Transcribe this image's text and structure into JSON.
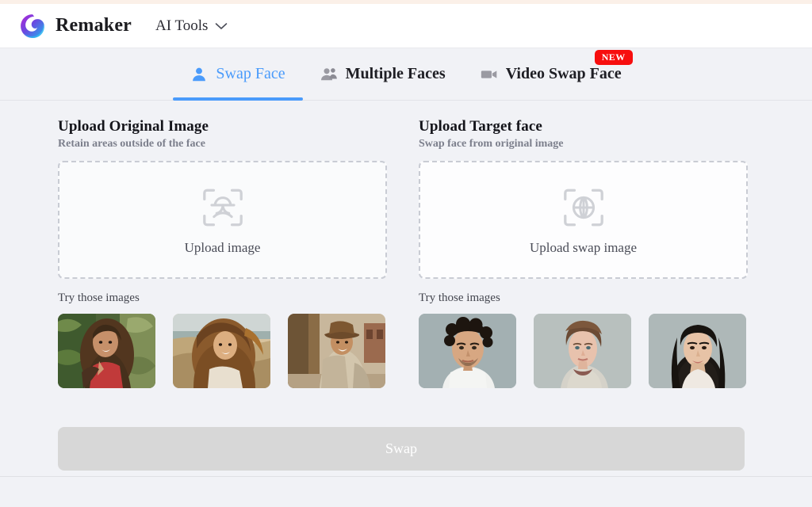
{
  "header": {
    "logo_icon": "remaker-swirl-logo",
    "brand": "Remaker",
    "nav_dropdown_label": "AI Tools",
    "chevron_icon": "chevron-down-icon"
  },
  "tabs": [
    {
      "label": "Swap Face",
      "icon": "single-person-icon",
      "active": true,
      "badge": ""
    },
    {
      "label": "Multiple Faces",
      "icon": "multiple-people-icon",
      "active": false,
      "badge": ""
    },
    {
      "label": "Video Swap Face",
      "icon": "video-camera-icon",
      "active": false,
      "badge": "NEW"
    }
  ],
  "panels": [
    {
      "title": "Upload Original Image",
      "subtitle": "Retain areas outside of the face",
      "dropzone_icon": "face-scan-icon",
      "dropzone_text": "Upload image",
      "try_label": "Try those images",
      "thumbnails": [
        {
          "name": "woman-red-top-garden"
        },
        {
          "name": "woman-curly-hair-beach"
        },
        {
          "name": "man-cowboy-hat-town"
        }
      ]
    },
    {
      "title": "Upload Target face",
      "subtitle": "Swap face from original image",
      "dropzone_icon": "globe-scan-icon",
      "dropzone_text": "Upload swap image",
      "try_label": "Try those images",
      "thumbnails": [
        {
          "name": "man-curly-hair-portrait"
        },
        {
          "name": "woman-light-hair-portrait"
        },
        {
          "name": "woman-dark-hair-portrait"
        }
      ]
    }
  ],
  "action": {
    "swap_label": "Swap",
    "swap_disabled": true
  },
  "colors": {
    "accent_blue": "#4a9bfb",
    "badge_red": "#f70e0e",
    "page_bg": "#f1f2f6",
    "disabled_gray": "#d7d7d7",
    "logo_purple": "#a22ad0",
    "logo_blue": "#2b9ae8"
  }
}
